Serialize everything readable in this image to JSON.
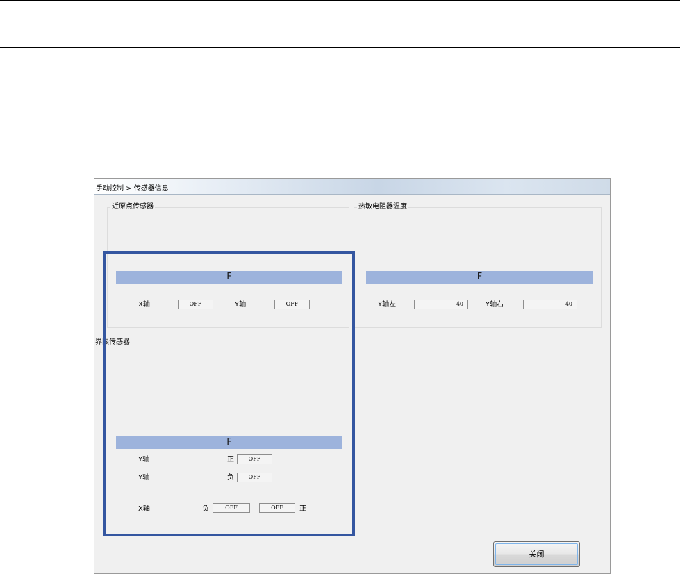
{
  "window": {
    "title": "手动控制 > 传感器信息"
  },
  "home_sensor": {
    "title": "近原点传感器",
    "band": "F",
    "x_label": "X轴",
    "x_value": "OFF",
    "y_label": "Y轴",
    "y_value": "OFF"
  },
  "thermistor": {
    "title": "热敏电阻器温度",
    "band": "F",
    "y_left_label": "Y轴左",
    "y_left_value": "40",
    "y_right_label": "Y轴右",
    "y_right_value": "40"
  },
  "limit_sensor": {
    "title": "界限传感器",
    "band": "F",
    "row1": {
      "axis": "Y轴",
      "dir": "正",
      "value": "OFF"
    },
    "row2": {
      "axis": "Y轴",
      "dir": "负",
      "value": "OFF"
    },
    "row3": {
      "axis": "X轴",
      "dir_neg": "负",
      "value_neg": "OFF",
      "value_pos": "OFF",
      "dir_pos": "正"
    }
  },
  "buttons": {
    "close": "关闭"
  },
  "colors": {
    "band": "#9db3dc",
    "highlight": "#3456a0",
    "focus": "#7eb4ea"
  }
}
